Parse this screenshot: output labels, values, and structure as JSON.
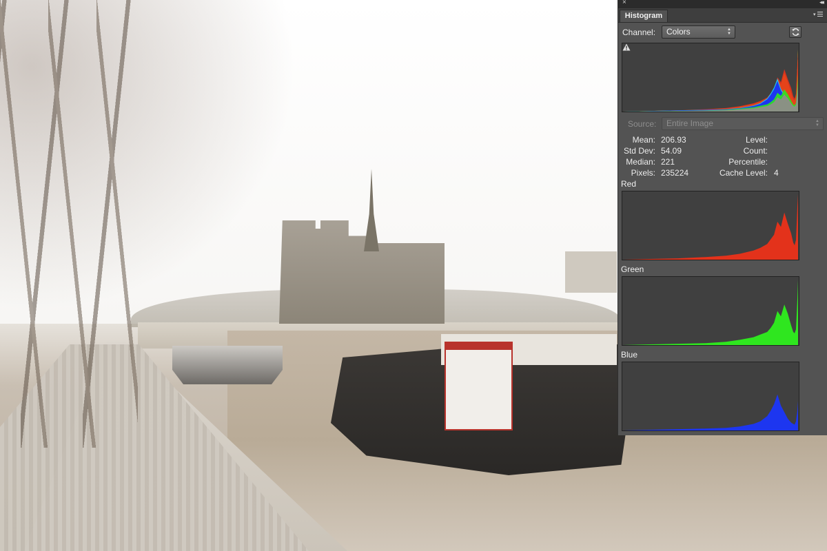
{
  "panel": {
    "tab_label": "Histogram",
    "close_glyph": "×",
    "collapse_glyph": "◂◂",
    "channel_label": "Channel:",
    "channel_value": "Colors",
    "source_label": "Source:",
    "source_value": "Entire Image",
    "icons": [
      "close-icon",
      "collapse-icon",
      "panel-menu-icon",
      "refresh-icon",
      "warning-icon"
    ]
  },
  "stats": {
    "mean_label": "Mean:",
    "mean_value": "206.93",
    "stddev_label": "Std Dev:",
    "stddev_value": "54.09",
    "median_label": "Median:",
    "median_value": "221",
    "pixels_label": "Pixels:",
    "pixels_value": "235224",
    "level_label": "Level:",
    "level_value": "",
    "count_label": "Count:",
    "count_value": "",
    "percentile_label": "Percentile:",
    "percentile_value": "",
    "cache_label": "Cache Level:",
    "cache_value": "4"
  },
  "channels": {
    "red_label": "Red",
    "green_label": "Green",
    "blue_label": "Blue"
  },
  "colors": {
    "red": "#e3321b",
    "green": "#2fe61f",
    "blue": "#1d36f0",
    "yellow": "#f2e21a",
    "cyan": "#22c6e8",
    "luminosity_gray": "#8a9184"
  },
  "chart_data": {
    "type": "area",
    "x_range": [
      0,
      255
    ],
    "series": [
      {
        "name": "Red",
        "x": [
          0,
          40,
          80,
          120,
          150,
          170,
          190,
          200,
          210,
          215,
          220,
          225,
          230,
          235,
          240,
          245,
          248,
          250,
          252,
          254,
          255
        ],
        "y": [
          0,
          1,
          2,
          4,
          6,
          9,
          14,
          18,
          24,
          31,
          38,
          58,
          50,
          72,
          55,
          40,
          26,
          22,
          30,
          80,
          100
        ]
      },
      {
        "name": "Green",
        "x": [
          0,
          40,
          80,
          120,
          150,
          170,
          190,
          200,
          210,
          215,
          220,
          225,
          230,
          235,
          240,
          245,
          248,
          250,
          252,
          254,
          255
        ],
        "y": [
          0,
          1,
          2,
          3,
          5,
          8,
          12,
          16,
          20,
          26,
          34,
          52,
          44,
          62,
          48,
          30,
          20,
          18,
          24,
          70,
          100
        ]
      },
      {
        "name": "Blue",
        "x": [
          0,
          40,
          80,
          120,
          150,
          170,
          190,
          200,
          210,
          215,
          220,
          225,
          230,
          235,
          240,
          245,
          248,
          250,
          252,
          254,
          255
        ],
        "y": [
          0,
          1,
          2,
          3,
          4,
          6,
          10,
          14,
          22,
          30,
          40,
          55,
          38,
          28,
          18,
          12,
          10,
          9,
          14,
          30,
          45
        ]
      }
    ]
  }
}
